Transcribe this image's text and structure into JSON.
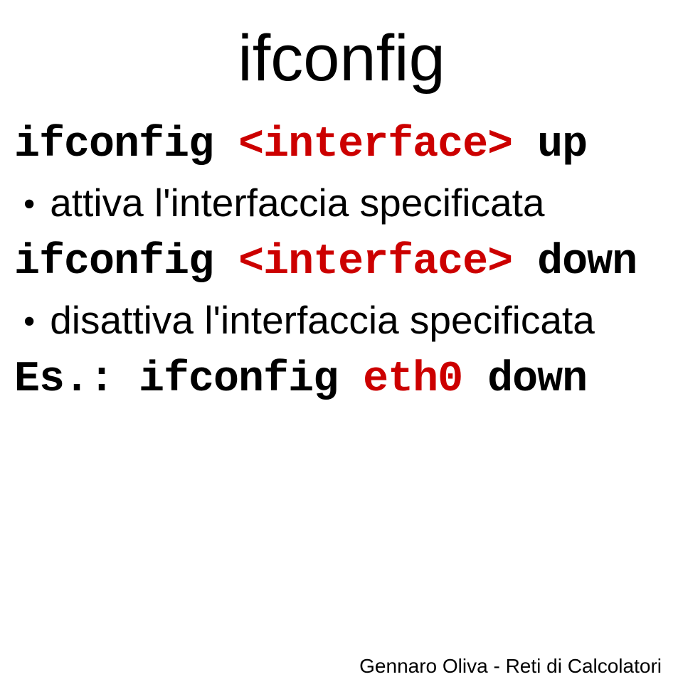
{
  "title": "ifconfig",
  "lines": [
    {
      "type": "command",
      "parts": [
        {
          "text": "ifconfig ",
          "color": "black"
        },
        {
          "text": "<interface>",
          "color": "red"
        },
        {
          "text": " up",
          "color": "black"
        }
      ]
    },
    {
      "type": "bullet",
      "text": "attiva l'interfaccia specificata"
    },
    {
      "type": "command",
      "parts": [
        {
          "text": "ifconfig ",
          "color": "black"
        },
        {
          "text": "<interface>",
          "color": "red"
        },
        {
          "text": " down",
          "color": "black"
        }
      ]
    },
    {
      "type": "bullet",
      "text": "disattiva l'interfaccia specificata"
    },
    {
      "type": "example",
      "parts": [
        {
          "text": "Es.: ifconfig ",
          "color": "black"
        },
        {
          "text": "eth0",
          "color": "red"
        },
        {
          "text": " down",
          "color": "black"
        }
      ]
    }
  ],
  "footer": "Gennaro Oliva - Reti di Calcolatori"
}
